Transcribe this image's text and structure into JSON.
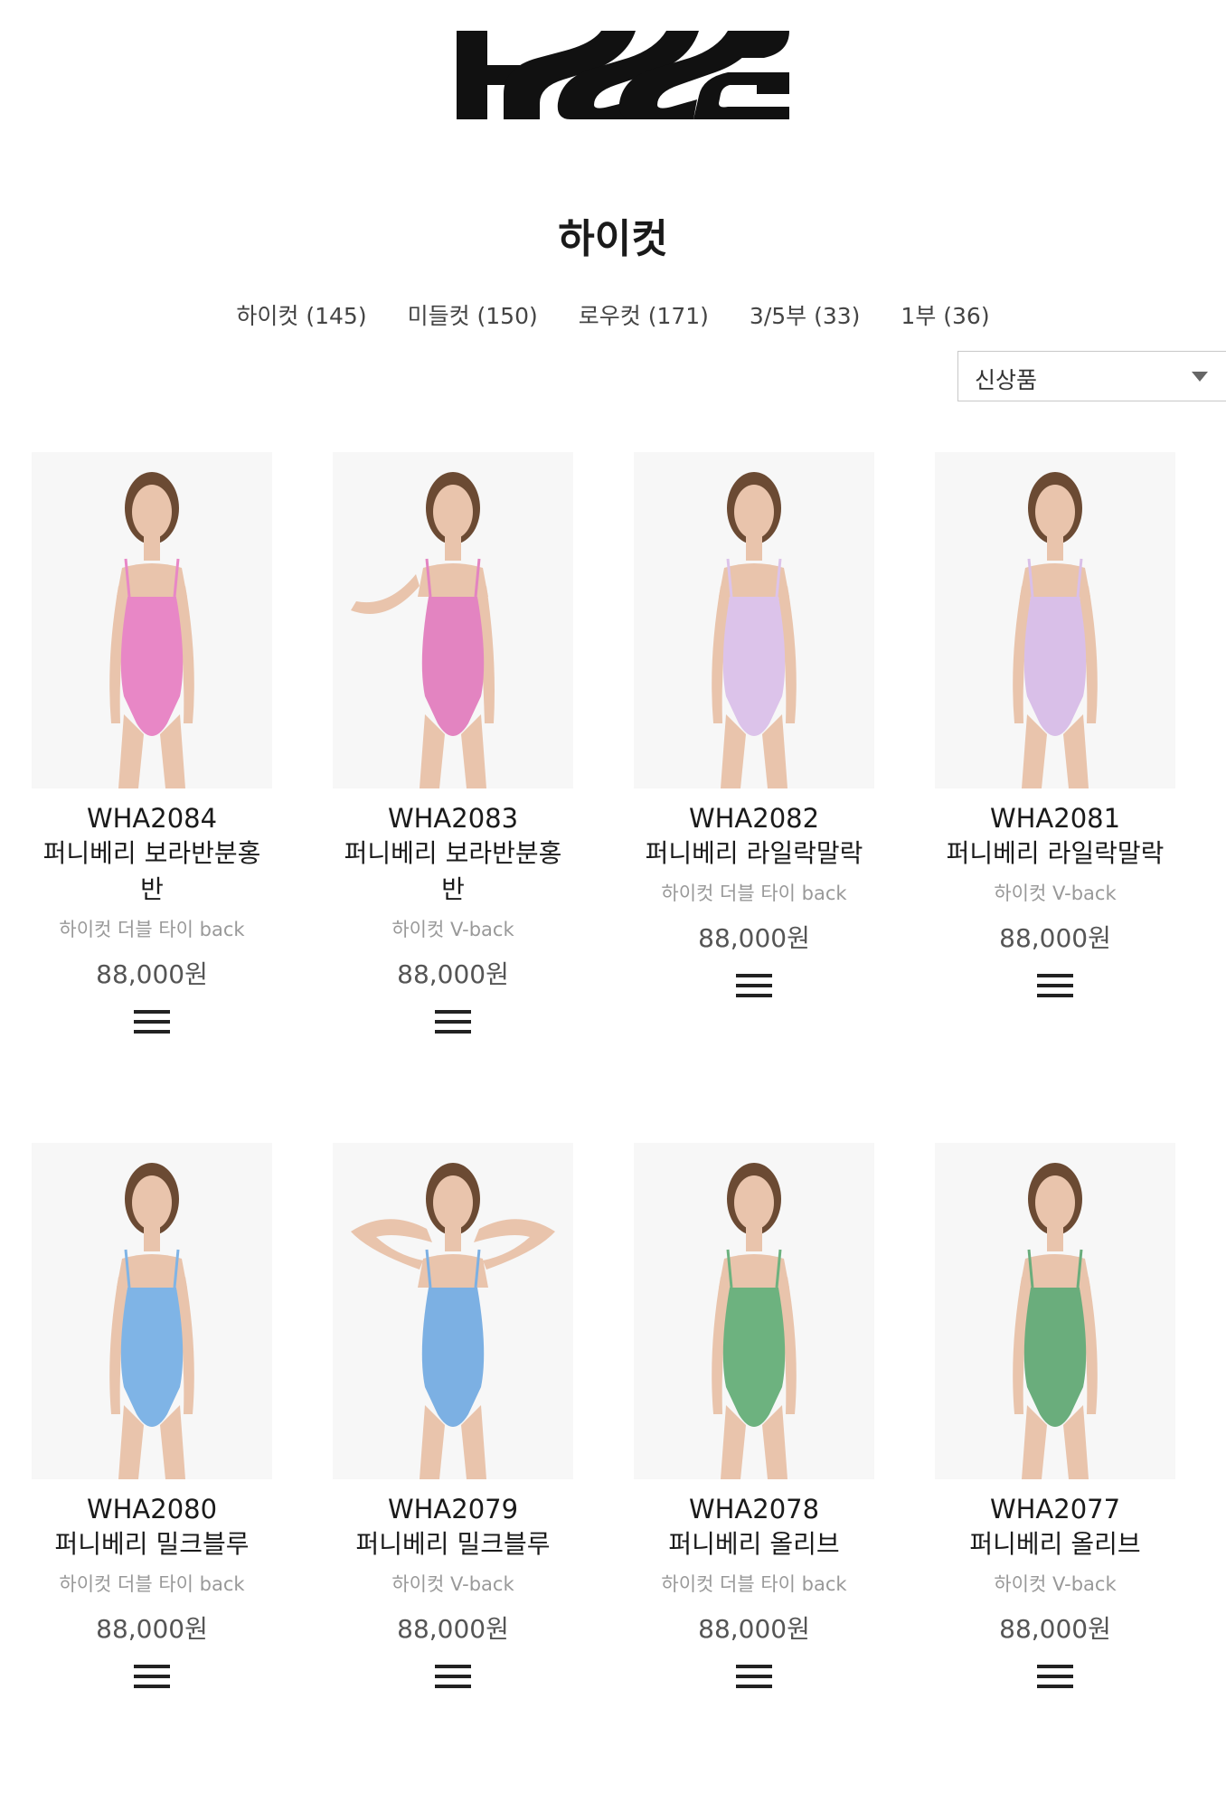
{
  "header": {
    "logo": "HOGG"
  },
  "page_title": "하이컷",
  "categories": [
    {
      "label": "하이컷 (145)"
    },
    {
      "label": "미들컷 (150)"
    },
    {
      "label": "로우컷 (171)"
    },
    {
      "label": "3/5부 (33)"
    },
    {
      "label": "1부 (36)"
    }
  ],
  "sort": {
    "selected": "신상품"
  },
  "products": [
    {
      "code": "WHA2084",
      "name": "퍼니베리 보라반분홍반",
      "type": "하이컷 더블 타이 back",
      "price": "88,000원",
      "color": "#e887c6",
      "pose": "front"
    },
    {
      "code": "WHA2083",
      "name": "퍼니베리 보라반분홍반",
      "type": "하이컷 V-back",
      "price": "88,000원",
      "color": "#e384c1",
      "pose": "arm"
    },
    {
      "code": "WHA2082",
      "name": "퍼니베리 라일락말락",
      "type": "하이컷 더블 타이 back",
      "price": "88,000원",
      "color": "#dcc3ea",
      "pose": "front"
    },
    {
      "code": "WHA2081",
      "name": "퍼니베리 라일락말락",
      "type": "하이컷 V-back",
      "price": "88,000원",
      "color": "#d9bfe8",
      "pose": "front"
    },
    {
      "code": "WHA2080",
      "name": "퍼니베리 밀크블루",
      "type": "하이컷 더블 타이 back",
      "price": "88,000원",
      "color": "#7fb4e6",
      "pose": "front"
    },
    {
      "code": "WHA2079",
      "name": "퍼니베리 밀크블루",
      "type": "하이컷 V-back",
      "price": "88,000원",
      "color": "#7cb0e3",
      "pose": "arms-up"
    },
    {
      "code": "WHA2078",
      "name": "퍼니베리 올리브",
      "type": "하이컷 더블 타이 back",
      "price": "88,000원",
      "color": "#6db27f",
      "pose": "front"
    },
    {
      "code": "WHA2077",
      "name": "퍼니베리 올리브",
      "type": "하이컷 V-back",
      "price": "88,000원",
      "color": "#6aad7c",
      "pose": "front"
    }
  ]
}
